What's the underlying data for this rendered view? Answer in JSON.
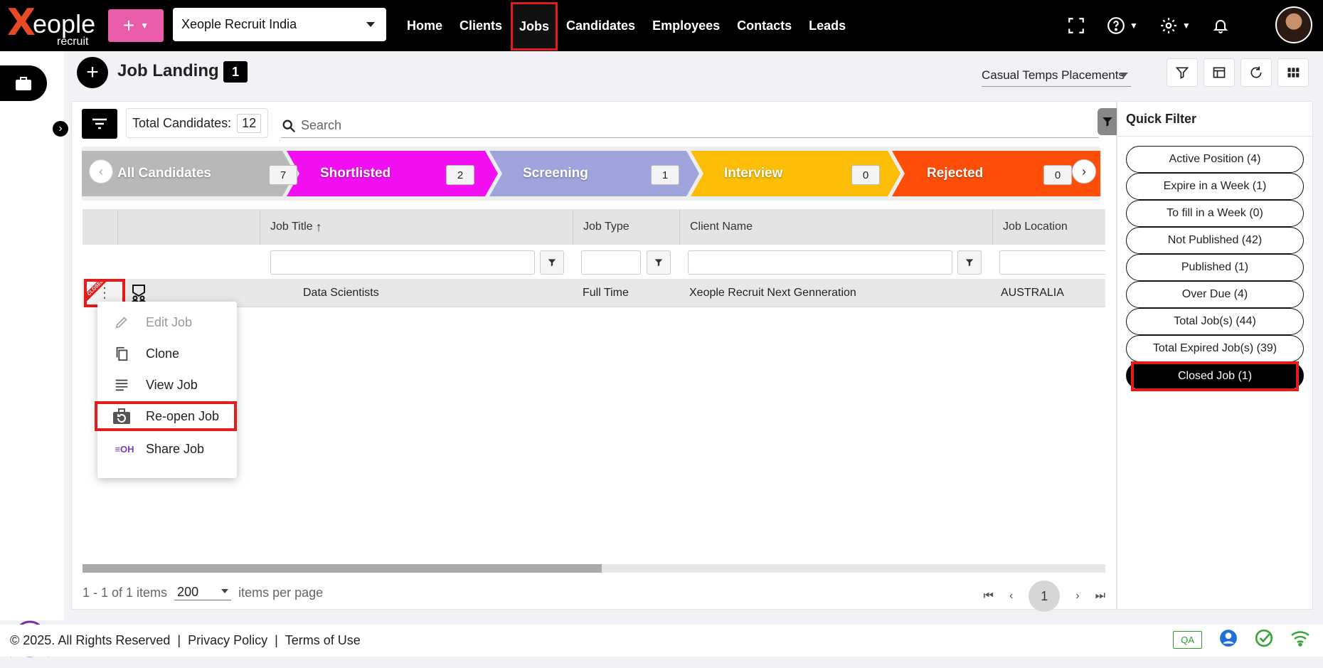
{
  "app": {
    "logo_main": "eople",
    "logo_x": "X",
    "logo_sub": "recruit",
    "org_select": "Xeople Recruit India",
    "nav": [
      "Home",
      "Clients",
      "Jobs",
      "Candidates",
      "Employees",
      "Contacts",
      "Leads"
    ],
    "active_nav": "Jobs"
  },
  "page": {
    "title": "Job Landing",
    "count": "1",
    "placement_select": "Casual Temps Placements"
  },
  "toolbar": {
    "total_label": "Total Candidates:",
    "total_value": "12",
    "search_placeholder": "Search"
  },
  "pipeline": [
    {
      "label": "All Candidates",
      "count": "7",
      "color": "#b8b8b8"
    },
    {
      "label": "Shortlisted",
      "count": "2",
      "color": "#f20ff2"
    },
    {
      "label": "Screening",
      "count": "1",
      "color": "#9fa4dc"
    },
    {
      "label": "Interview",
      "count": "0",
      "color": "#fbbd08"
    },
    {
      "label": "Rejected",
      "count": "0",
      "color": "#ff4d0a"
    }
  ],
  "grid": {
    "columns": [
      "Job Title",
      "Job Type",
      "Client Name",
      "Job Location"
    ],
    "sort_indicator": "↑",
    "rows": [
      {
        "job_title": "Data Scientists",
        "job_type": "Full Time",
        "client_name": "Xeople Recruit Next Genneration",
        "job_location": "AUSTRALIA",
        "ribbon": "CLOSED"
      }
    ]
  },
  "row_menu": [
    {
      "label": "Edit Job",
      "icon": "pencil-icon",
      "disabled": true
    },
    {
      "label": "Clone",
      "icon": "copy-icon"
    },
    {
      "label": "View Job",
      "icon": "lines-icon"
    },
    {
      "label": "Re-open Job",
      "icon": "reopen-briefcase-icon"
    },
    {
      "label": "Share Job",
      "icon": "eoh-share-icon",
      "icon_text": "≡OH"
    }
  ],
  "pager": {
    "summary": "1 - 1 of 1 items",
    "page_size": "200",
    "per_page_label": "items per page",
    "current_page": "1"
  },
  "quick_filter": {
    "title": "Quick Filter",
    "items": [
      "Active Position (4)",
      "Expire in a Week (1)",
      "To fill in a Week (0)",
      "Not Published (42)",
      "Published (1)",
      "Over Due (4)",
      "Total Job(s) (44)",
      "Total Expired Job(s) (39)",
      "Closed Job (1)"
    ],
    "active_index": 8
  },
  "footer": {
    "copyright": "© 2025. All Rights Reserved",
    "privacy": "Privacy Policy",
    "terms": "Terms of Use",
    "qa": "QA"
  },
  "colors": {
    "accent_red": "#e21c1c",
    "brand_pink": "#e95ca7",
    "brand_orange": "#e84a27"
  }
}
